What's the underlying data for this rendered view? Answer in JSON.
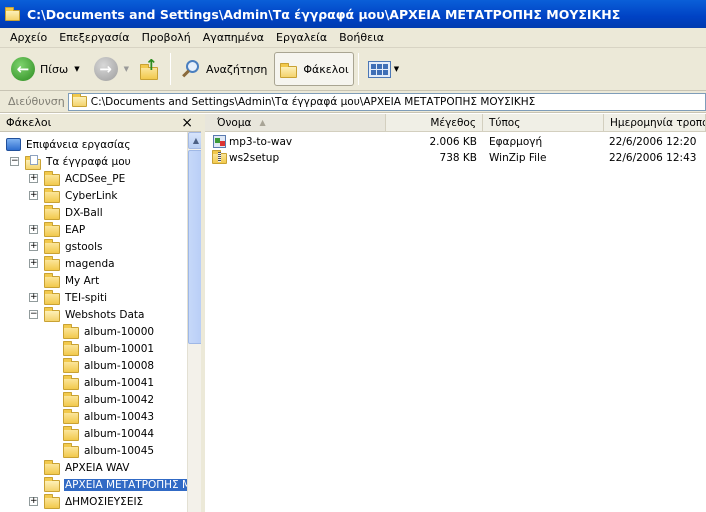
{
  "window": {
    "title": "C:\\Documents and Settings\\Admin\\Τα έγγραφά μου\\ΑΡΧΕΙΑ ΜΕΤΑΤΡΟΠΗΣ ΜΟΥΣΙΚΗΣ"
  },
  "menu": [
    "Αρχείο",
    "Επεξεργασία",
    "Προβολή",
    "Αγαπημένα",
    "Εργαλεία",
    "Βοήθεια"
  ],
  "toolbar": {
    "back_label": "Πίσω",
    "search_label": "Αναζήτηση",
    "folders_label": "Φάκελοι"
  },
  "address": {
    "label": "Διεύθυνση",
    "value": "C:\\Documents and Settings\\Admin\\Τα έγγραφά μου\\ΑΡΧΕΙΑ ΜΕΤΑΤΡΟΠΗΣ ΜΟΥΣΙΚΗΣ"
  },
  "folders_panel": {
    "title": "Φάκελοι",
    "close": "×"
  },
  "tree": [
    {
      "label": "Επιφάνεια εργασίας"
    },
    {
      "label": "Τα έγγραφά μου"
    },
    {
      "label": "ACDSee_PE"
    },
    {
      "label": "CyberLink"
    },
    {
      "label": "DX-Ball"
    },
    {
      "label": "EAP"
    },
    {
      "label": "gstools"
    },
    {
      "label": "magenda"
    },
    {
      "label": "My Art"
    },
    {
      "label": "TEI-spiti"
    },
    {
      "label": "Webshots Data"
    },
    {
      "label": "album-10000"
    },
    {
      "label": "album-10001"
    },
    {
      "label": "album-10008"
    },
    {
      "label": "album-10041"
    },
    {
      "label": "album-10042"
    },
    {
      "label": "album-10043"
    },
    {
      "label": "album-10044"
    },
    {
      "label": "album-10045"
    },
    {
      "label": "ΑΡΧΕΙΑ WAV"
    },
    {
      "label": "ΑΡΧΕΙΑ ΜΕΤΑΤΡΟΠΗΣ ΜΟ"
    },
    {
      "label": "ΔΗΜΟΣΙΕΥΣΕΙΣ"
    }
  ],
  "columns": [
    "Όνομα",
    "Μέγεθος",
    "Τύπος",
    "Ημερομηνία τροπο..."
  ],
  "files": [
    {
      "name": "mp3-to-wav",
      "size": "2.006 KB",
      "type": "Εφαρμογή",
      "date": "22/6/2006 12:20"
    },
    {
      "name": "ws2setup",
      "size": "738 KB",
      "type": "WinZip File",
      "date": "22/6/2006 12:43"
    }
  ]
}
